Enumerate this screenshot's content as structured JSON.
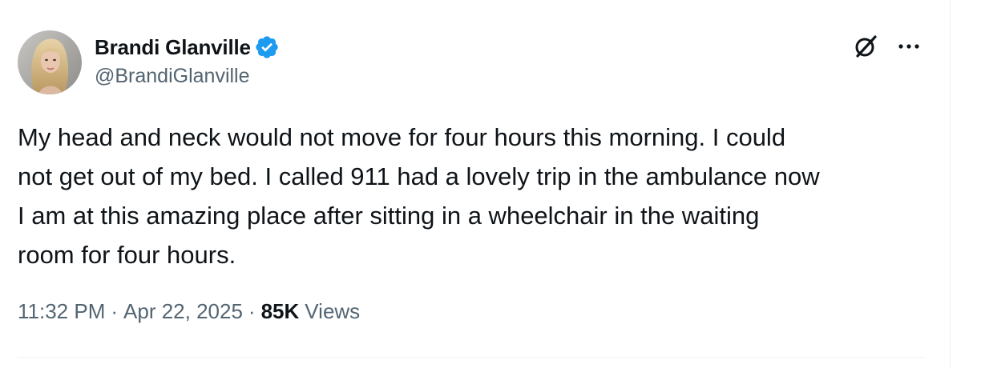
{
  "user": {
    "display_name": "Brandi Glanville",
    "handle": "@BrandiGlanville",
    "verified": true
  },
  "actions": {
    "grok_icon": "grok-icon",
    "more_icon": "more-icon"
  },
  "tweet": {
    "text": "My head and neck would not move for four hours this morning. I could\nnot get out of my bed. I called 911 had a lovely trip in the ambulance now\nI am at this amazing place after sitting in a wheelchair in the waiting\nroom for four hours.",
    "time": "11:32 PM",
    "separator": "·",
    "date": "Apr 22, 2025",
    "views_count": "85K",
    "views_label": "Views"
  },
  "colors": {
    "text_primary": "#0f1419",
    "text_secondary": "#536471",
    "verified_blue": "#1d9bf0",
    "divider": "#eff3f4"
  }
}
